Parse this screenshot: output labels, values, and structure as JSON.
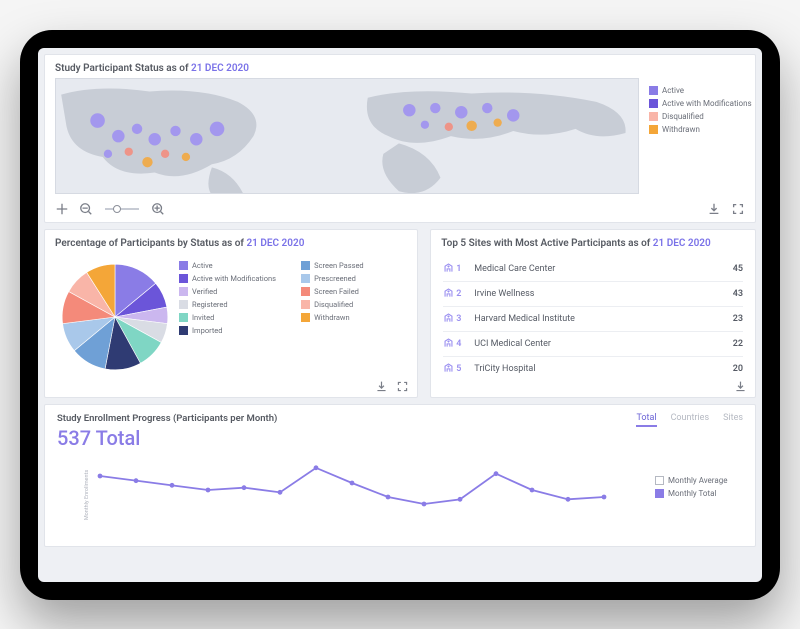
{
  "colors": {
    "active": "#8a7ce6",
    "active_mod": "#6b55d9",
    "verified": "#cbb7ef",
    "registered": "#d9dce4",
    "invited": "#7fd6c4",
    "imported": "#2f3b73",
    "screen_passed": "#6fa0d6",
    "prescreened": "#a9c8ea",
    "screen_failed": "#f48a7a",
    "disqualified": "#f9b5a8",
    "withdrawn": "#f4a638"
  },
  "map_card": {
    "title_prefix": "Study Participant Status as of",
    "as_of": "21 DEC 2020",
    "legend": [
      {
        "label": "Active",
        "color": "#8a7ce6"
      },
      {
        "label": "Active with Modifications",
        "color": "#6b55d9"
      },
      {
        "label": "Disqualified",
        "color": "#f9b5a8"
      },
      {
        "label": "Withdrawn",
        "color": "#f4a638"
      }
    ]
  },
  "pie_card": {
    "title_prefix": "Percentage of Participants by Status as of",
    "as_of": "21 DEC 2020",
    "legend_col1": [
      {
        "label": "Active",
        "color": "#8a7ce6"
      },
      {
        "label": "Active with Modifications",
        "color": "#6b55d9"
      },
      {
        "label": "Verified",
        "color": "#cbb7ef"
      },
      {
        "label": "Registered",
        "color": "#d9dce4"
      },
      {
        "label": "Invited",
        "color": "#7fd6c4"
      },
      {
        "label": "Imported",
        "color": "#2f3b73"
      }
    ],
    "legend_col2": [
      {
        "label": "Screen Passed",
        "color": "#6fa0d6"
      },
      {
        "label": "Prescreened",
        "color": "#a9c8ea"
      },
      {
        "label": "Screen Failed",
        "color": "#f48a7a"
      },
      {
        "label": "Disqualified",
        "color": "#f9b5a8"
      },
      {
        "label": "Withdrawn",
        "color": "#f4a638"
      }
    ]
  },
  "sites_card": {
    "title_prefix": "Top 5 Sites with Most Active Participants as of",
    "as_of": "21 DEC 2020",
    "rows": [
      {
        "rank": "1",
        "name": "Medical Care Center",
        "count": "45"
      },
      {
        "rank": "2",
        "name": "Irvine Wellness",
        "count": "43"
      },
      {
        "rank": "3",
        "name": "Harvard Medical Institute",
        "count": "23"
      },
      {
        "rank": "4",
        "name": "UCI Medical Center",
        "count": "22"
      },
      {
        "rank": "5",
        "name": "TriCity Hospital",
        "count": "20"
      }
    ]
  },
  "line_card": {
    "title": "Study Enrollment Progress (Participants per Month)",
    "total_label": "537 Total",
    "tabs": {
      "total": "Total",
      "countries": "Countries",
      "sites": "Sites"
    },
    "legend": [
      {
        "label": "Monthly Average",
        "color": "#ffffff",
        "border": "#b5b9c2"
      },
      {
        "label": "Monthly Total",
        "color": "#8a7ce6"
      }
    ],
    "ylabel": "Monthly Enrollments"
  },
  "chart_data": [
    {
      "type": "pie",
      "title": "Percentage of Participants by Status as of 21 DEC 2020",
      "series": [
        {
          "name": "Active",
          "value": 14,
          "color": "#8a7ce6"
        },
        {
          "name": "Active with Modifications",
          "value": 8,
          "color": "#6b55d9"
        },
        {
          "name": "Verified",
          "value": 5,
          "color": "#cbb7ef"
        },
        {
          "name": "Registered",
          "value": 6,
          "color": "#d9dce4"
        },
        {
          "name": "Invited",
          "value": 9,
          "color": "#7fd6c4"
        },
        {
          "name": "Imported",
          "value": 11,
          "color": "#2f3b73"
        },
        {
          "name": "Screen Passed",
          "value": 11,
          "color": "#6fa0d6"
        },
        {
          "name": "Prescreened",
          "value": 9,
          "color": "#a9c8ea"
        },
        {
          "name": "Screen Failed",
          "value": 10,
          "color": "#f48a7a"
        },
        {
          "name": "Disqualified",
          "value": 8,
          "color": "#f9b5a8"
        },
        {
          "name": "Withdrawn",
          "value": 9,
          "color": "#f4a638"
        }
      ]
    },
    {
      "type": "line",
      "title": "Study Enrollment Progress (Participants per Month)",
      "ylabel": "Monthly Enrollments",
      "x_count": 15,
      "series": [
        {
          "name": "Monthly Total",
          "color": "#8a7ce6",
          "values": [
            48,
            44,
            40,
            36,
            38,
            34,
            55,
            42,
            30,
            24,
            28,
            50,
            36,
            28,
            30
          ]
        }
      ],
      "ylim": [
        0,
        60
      ]
    }
  ]
}
